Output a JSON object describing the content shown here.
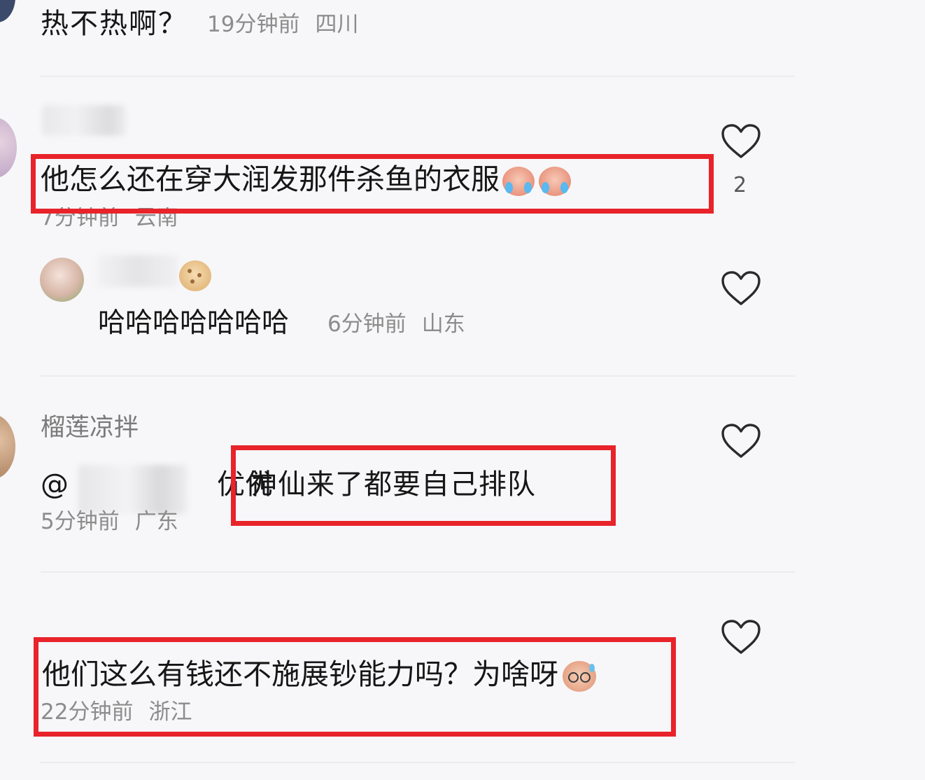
{
  "comments": [
    {
      "text": "热不热啊？",
      "time": "19分钟前",
      "location": "四川"
    },
    {
      "username": "",
      "text": "他怎么还在穿大润发那件杀鱼的衣服",
      "emoji": "cry-laugh-face",
      "time": "7分钟前",
      "location": "云南",
      "likes": "2",
      "reply": {
        "text": "哈哈哈哈哈哈哈",
        "time": "6分钟前",
        "location": "山东"
      }
    },
    {
      "username": "榴莲凉拌",
      "mention_prefix": "@",
      "mention_suffix": "优优",
      "text": "神仙来了都要自己排队",
      "time": "5分钟前",
      "location": "广东"
    },
    {
      "text": "他们这么有钱还不施展钞能力吗？为啥呀",
      "emoji": "sweat-glasses-face",
      "time": "22分钟前",
      "location": "浙江"
    }
  ],
  "colors": {
    "highlight_border": "#e8232a",
    "meta_text": "#8c8c8c",
    "main_text": "#161616",
    "background": "#f7f7f9"
  },
  "icons": {
    "like": "heart-outline-icon",
    "avatar": "user-avatar"
  }
}
